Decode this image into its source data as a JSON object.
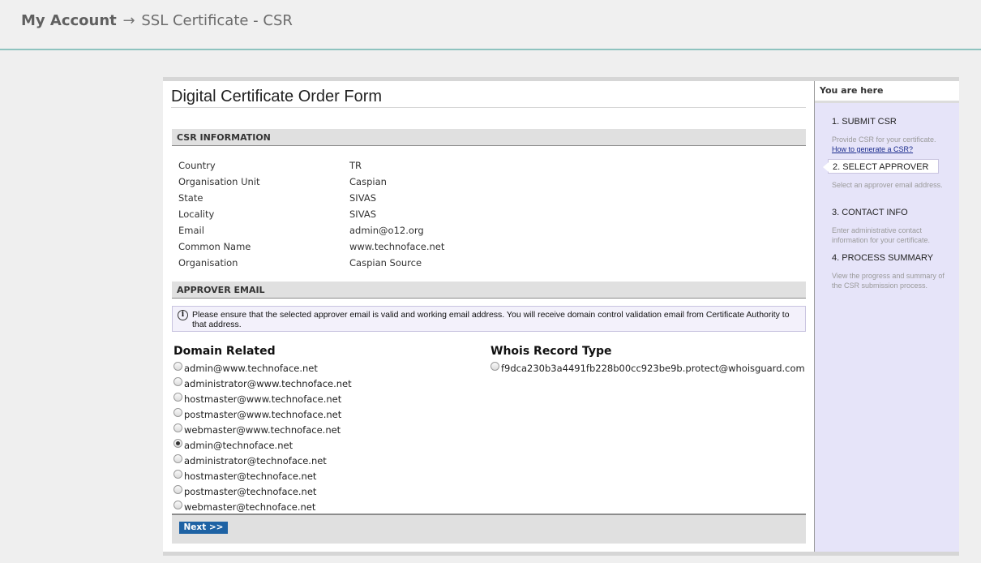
{
  "breadcrumb": {
    "root": "My Account",
    "separator": "→",
    "current": "SSL Certificate - CSR"
  },
  "form": {
    "title": "Digital Certificate Order Form",
    "csr_section": "CSR INFORMATION",
    "csr_fields": [
      {
        "label": "Country",
        "value": "TR"
      },
      {
        "label": "Organisation Unit",
        "value": "Caspian"
      },
      {
        "label": "State",
        "value": "SIVAS"
      },
      {
        "label": "Locality",
        "value": "SIVAS"
      },
      {
        "label": "Email",
        "value": "admin@o12.org"
      },
      {
        "label": "Common Name",
        "value": "www.technoface.net"
      },
      {
        "label": "Organisation",
        "value": "Caspian Source"
      }
    ],
    "approver_section": "APPROVER EMAIL",
    "notice": "Please ensure that the selected approver email is valid and working email address. You will receive domain control validation email from Certificate Authority to that address.",
    "domain_heading": "Domain Related",
    "domain_emails": [
      "admin@www.technoface.net",
      "administrator@www.technoface.net",
      "hostmaster@www.technoface.net",
      "postmaster@www.technoface.net",
      "webmaster@www.technoface.net",
      "admin@technoface.net",
      "administrator@technoface.net",
      "hostmaster@technoface.net",
      "postmaster@technoface.net",
      "webmaster@technoface.net"
    ],
    "selected_email": "admin@technoface.net",
    "whois_heading": "Whois Record Type",
    "whois_emails": [
      "f9dca230b3a4491fb228b00cc923be9b.protect@whoisguard.com"
    ],
    "next_label": "Next >>"
  },
  "sidebar": {
    "here_label": "You are here",
    "steps": [
      {
        "title": "1. SUBMIT CSR",
        "desc": "Provide CSR for your certificate.",
        "link": "How to generate a CSR?"
      },
      {
        "title": "2. SELECT APPROVER",
        "desc": "Select an approver email address.",
        "active": true
      },
      {
        "title": "3. CONTACT INFO",
        "desc": "Enter administrative contact information for your certificate."
      },
      {
        "title": "4. PROCESS SUMMARY",
        "desc": "View the progress and summary of the CSR submission process."
      }
    ]
  },
  "colors": {
    "accent_line": "#8ec3bf",
    "sidebar_bg": "#e6e4f9",
    "button_bg": "#1e62a4"
  }
}
